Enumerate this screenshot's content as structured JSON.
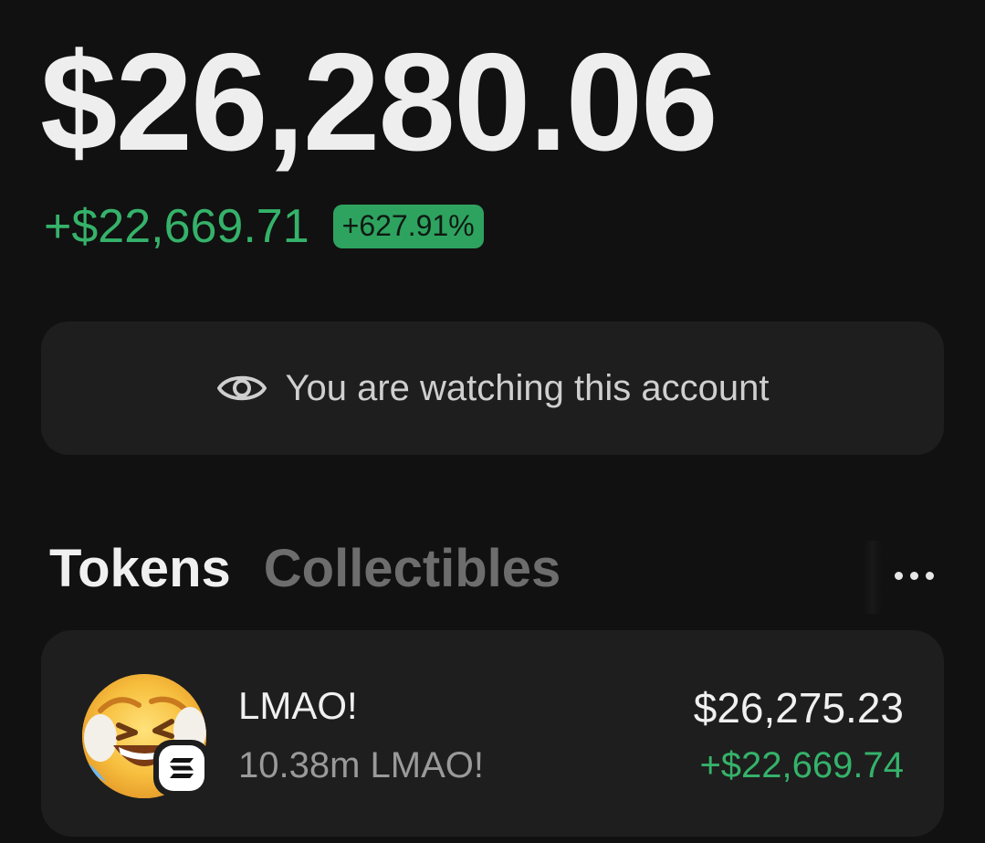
{
  "portfolio": {
    "balance": "$26,280.06",
    "change_amount": "+$22,669.71",
    "change_percent": "+627.91%"
  },
  "watch_banner": {
    "icon": "eye-icon",
    "text": "You are watching this account"
  },
  "tabs": [
    {
      "label": "Tokens",
      "active": true
    },
    {
      "label": "Collectibles",
      "active": false
    }
  ],
  "more_menu": {
    "icon": "more-dots-icon"
  },
  "tokens": [
    {
      "name": "LMAO!",
      "quantity": "10.38m LMAO!",
      "value": "$26,275.23",
      "change": "+$22,669.74",
      "avatar_icon": "laughing-emoji-avatar",
      "chain_icon": "solana-icon"
    }
  ],
  "colors": {
    "background": "#111111",
    "card": "#1e1e1e",
    "positive": "#35b26a",
    "badge": "#2ea35f",
    "text_primary": "#eeeeee",
    "text_secondary": "#9a9a9a",
    "tab_inactive": "#6d6d6d"
  }
}
